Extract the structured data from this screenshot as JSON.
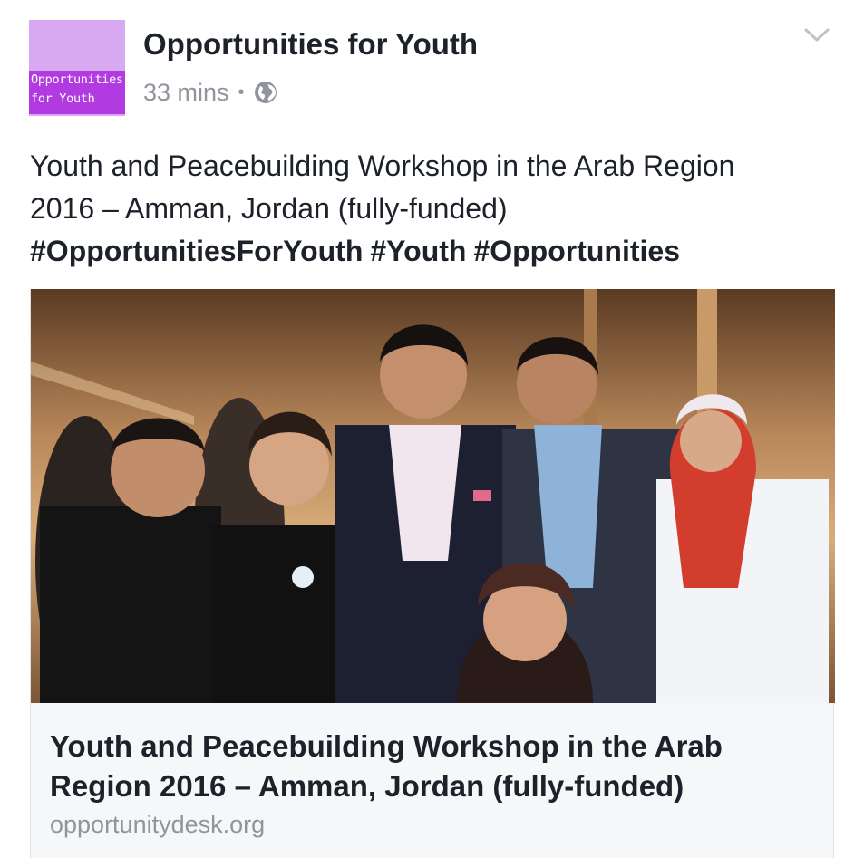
{
  "post": {
    "page_avatar": {
      "line1": "Opportunities",
      "line2": "for Youth",
      "bg_color": "#d8a8f0",
      "band_color": "#b13be0"
    },
    "page_name": "Opportunities for Youth",
    "timestamp": "33 mins",
    "separator": "•",
    "privacy_icon": "globe-icon",
    "menu_icon": "chevron-down-icon",
    "text_lines": [
      "Youth and Peacebuilding Workshop in the Arab Region",
      "2016 – Amman, Jordan (fully-funded)"
    ],
    "hashtags": [
      "#OpportunitiesForYouth",
      "#Youth",
      "#Opportunities"
    ]
  },
  "link_card": {
    "title_lines": [
      "Youth and Peacebuilding Workshop in the Arab",
      "Region 2016 – Amman, Jordan (fully-funded)"
    ],
    "domain": "opportunitydesk.org"
  },
  "colors": {
    "text_primary": "#1d2129",
    "text_secondary": "#90949c",
    "card_bg": "#f6f7f9",
    "card_border": "#dddfe2"
  }
}
